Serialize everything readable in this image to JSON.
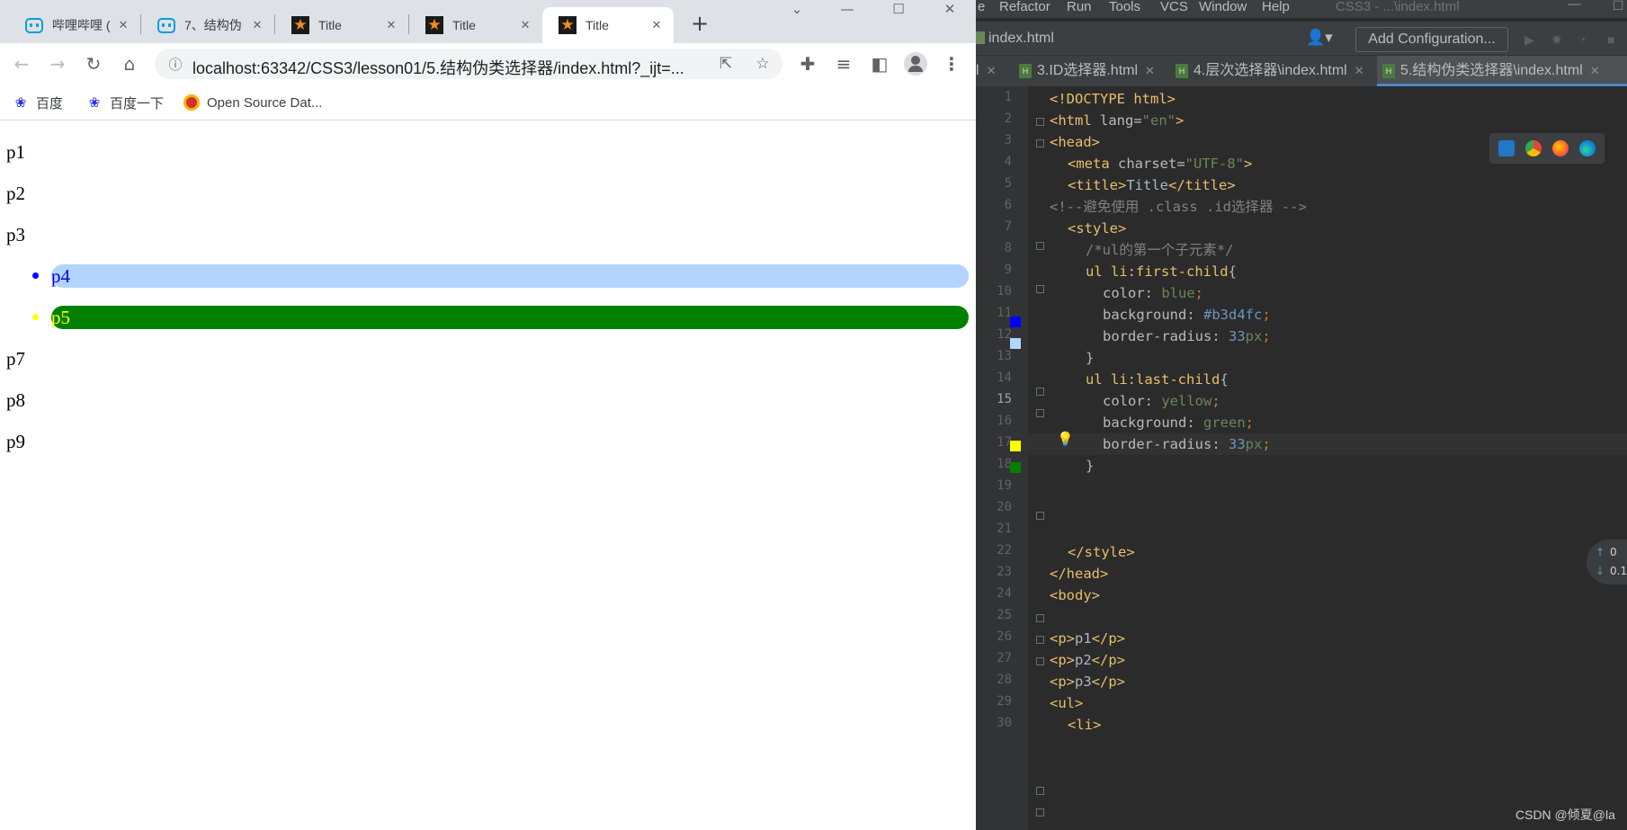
{
  "browser": {
    "tabs": [
      {
        "label": "哔哩哔哩 (",
        "icon": "bilibili-icon"
      },
      {
        "label": "7、结构伪",
        "icon": "bilibili-icon"
      },
      {
        "label": "Title",
        "icon": "intellij-star-icon"
      },
      {
        "label": "Title",
        "icon": "intellij-star-icon"
      },
      {
        "label": "Title",
        "icon": "intellij-star-icon",
        "active": true
      }
    ],
    "url": "localhost:63342/CSS3/lesson01/5.结构伪类选择器/index.html?_ijt=...",
    "bookmarks": [
      {
        "label": "百度",
        "icon": "baidu-paw-icon"
      },
      {
        "label": "百度一下",
        "icon": "baidu-paw-icon"
      },
      {
        "label": "Open Source Dat...",
        "icon": "open-source-data-icon"
      }
    ]
  },
  "page": {
    "paragraphs_top": [
      "p1",
      "p2",
      "p3"
    ],
    "list_items": [
      {
        "text": "p4",
        "color": "#0000ff",
        "background": "#b3d4fc"
      },
      {
        "text": "p5",
        "color": "#ffff00",
        "background": "#008000"
      }
    ],
    "paragraphs_bottom": [
      "p7",
      "p8",
      "p9"
    ]
  },
  "ide": {
    "menu": [
      "e",
      "Refactor",
      "Run",
      "Tools",
      "VCS",
      "Window",
      "Help"
    ],
    "title": "CSS3 - ...\\index.html",
    "breadcrumb": "index.html",
    "add_configuration": "Add Configuration...",
    "tabs": [
      {
        "label": "l"
      },
      {
        "label": "3.ID选择器.html"
      },
      {
        "label": "4.层次选择器\\index.html"
      },
      {
        "label": "5.结构伪类选择器\\index.html",
        "active": true
      }
    ],
    "line_numbers": [
      "1",
      "2",
      "3",
      "4",
      "5",
      "6",
      "7",
      "8",
      "9",
      "10",
      "11",
      "12",
      "13",
      "14",
      "15",
      "16",
      "17",
      "18",
      "19",
      "20",
      "21",
      "22",
      "23",
      "24",
      "25",
      "26",
      "27",
      "28",
      "29",
      "30"
    ],
    "code": {
      "l1_tag": "<!DOCTYPE html>",
      "l2_open": "<html ",
      "l2_attr": "lang=",
      "l2_val": "\"en\"",
      "l2_close": ">",
      "l3": "<head>",
      "l4_open": "<meta ",
      "l4_attr": "charset=",
      "l4_val": "\"UTF-8\"",
      "l4_close": ">",
      "l5_open": "<title>",
      "l5_text": "Title",
      "l5_close": "</title>",
      "l6": "<!--避免使用 .class .id选择器 -->",
      "l7": "<style>",
      "l8": "/*ul的第一个子元素*/",
      "l9_sel": "ul li:first-child",
      "l9_brace": "{",
      "l10_prop": "color",
      "l10_colon": ": ",
      "l10_val": "blue",
      "l10_semi": ";",
      "l11_prop": "background",
      "l11_colon": ": ",
      "l11_val": "#b3d4fc",
      "l11_semi": ";",
      "l12_prop": "border-radius",
      "l12_colon": ": ",
      "l12_num": "33",
      "l12_unit": "px",
      "l12_semi": ";",
      "l13": "}",
      "l14_sel": "ul li:last-child",
      "l14_brace": "{",
      "l15_prop": "color",
      "l15_colon": ": ",
      "l15_val": "yellow",
      "l15_semi": ";",
      "l16_prop": "background",
      "l16_colon": ": ",
      "l16_val": "green",
      "l16_semi": ";",
      "l17_prop": "border-radius",
      "l17_colon": ": ",
      "l17_num": "33",
      "l17_unit": "px",
      "l17_semi": ";",
      "l18": "}",
      "l22": "</style>",
      "l23": "</head>",
      "l24": "<body>",
      "l26_open": "<p>",
      "l26_text": "p1",
      "l26_close": "</p>",
      "l27_open": "<p>",
      "l27_text": "p2",
      "l27_close": "</p>",
      "l28_open": "<p>",
      "l28_text": "p3",
      "l28_close": "</p>",
      "l29": "<ul>",
      "l30": "<li>"
    },
    "gutter_swatches": [
      {
        "line": "10",
        "color": "#0000ff"
      },
      {
        "line": "11",
        "color": "#b3d4fc"
      },
      {
        "line": "15",
        "color": "#ffff00"
      },
      {
        "line": "16",
        "color": "#008000"
      }
    ],
    "network_widget": {
      "up": "0",
      "down": "0.1"
    }
  },
  "watermark": "CSDN @倾夏@la"
}
